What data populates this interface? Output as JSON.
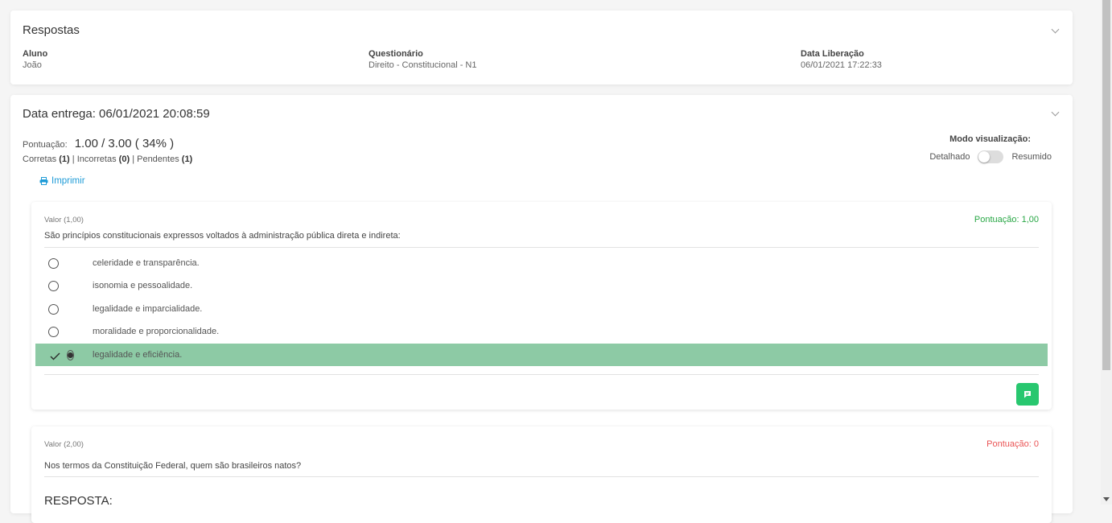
{
  "header": {
    "title": "Respostas",
    "aluno_label": "Aluno",
    "aluno_value": "João",
    "questionario_label": "Questionário",
    "questionario_value": "Direito - Constitucional - N1",
    "liberacao_label": "Data Liberação",
    "liberacao_value": "06/01/2021 17:22:33"
  },
  "delivery": {
    "title": "Data entrega: 06/01/2021 20:08:59",
    "score_label": "Pontuação:",
    "score_value": "1.00 / 3.00 ( 34% )",
    "corretas_label": "Corretas",
    "corretas_count": "(1)",
    "incorretas_label": "Incorretas",
    "incorretas_count": "(0)",
    "pendentes_label": "Pendentes",
    "pendentes_count": "(1)",
    "separator": "|",
    "print_label": "Imprimir",
    "mode_label": "Modo visualização:",
    "mode_left": "Detalhado",
    "mode_right": "Resumido"
  },
  "questions": [
    {
      "value": "Valor (1,00)",
      "points": "Pontuação: 1,00",
      "points_color": "#28a745",
      "text": "São princípios constitucionais expressos voltados à administração pública direta e indireta:",
      "options": [
        {
          "label": "celeridade e transparência.",
          "selected": false
        },
        {
          "label": "isonomia e pessoalidade.",
          "selected": false
        },
        {
          "label": "legalidade e imparcialidade.",
          "selected": false
        },
        {
          "label": "moralidade e proporcionalidade.",
          "selected": false
        },
        {
          "label": "legalidade e eficiência.",
          "selected": true
        }
      ]
    },
    {
      "value": "Valor (2,00)",
      "points": "Pontuação: 0",
      "points_color": "#ea5455",
      "text": "Nos termos da Constituição Federal, quem são brasileiros natos?",
      "answer_heading": "RESPOSTA:"
    }
  ],
  "colors": {
    "accent": "#1e9bd7",
    "correct_row": "#8dcaa5",
    "chat_button": "#28c76f"
  },
  "icons": {
    "print": "printer-icon",
    "check": "check-icon",
    "chat": "comment-icon",
    "collapse": "chevron-down-icon"
  }
}
